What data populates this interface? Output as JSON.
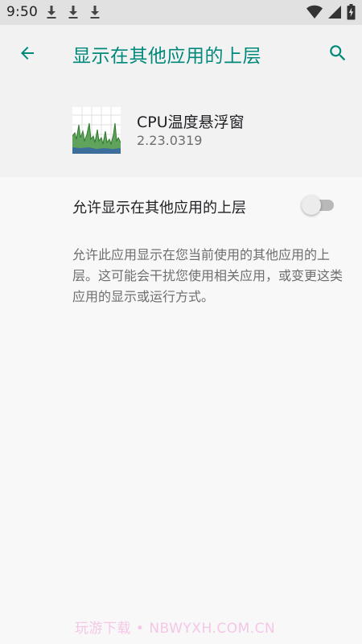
{
  "status_bar": {
    "time": "9:50",
    "icons": [
      "download-icon",
      "download-icon",
      "download-icon",
      "wifi-icon",
      "signal-icon",
      "battery-charging-icon"
    ]
  },
  "app_bar": {
    "title": "显示在其他应用的上层",
    "back_icon": "arrow-back-icon",
    "search_icon": "search-icon",
    "accent_color": "#00897b"
  },
  "app_info": {
    "name": "CPU温度悬浮窗",
    "version": "2.23.0319"
  },
  "setting": {
    "label": "允许显示在其他应用的上层",
    "enabled": false
  },
  "description": "允许此应用显示在您当前使用的其他应用的上层。这可能会干扰您使用相关应用，或变更这类应用的显示或运行方式。",
  "watermark": "玩游下载 • NBWYXH.COM.CN"
}
